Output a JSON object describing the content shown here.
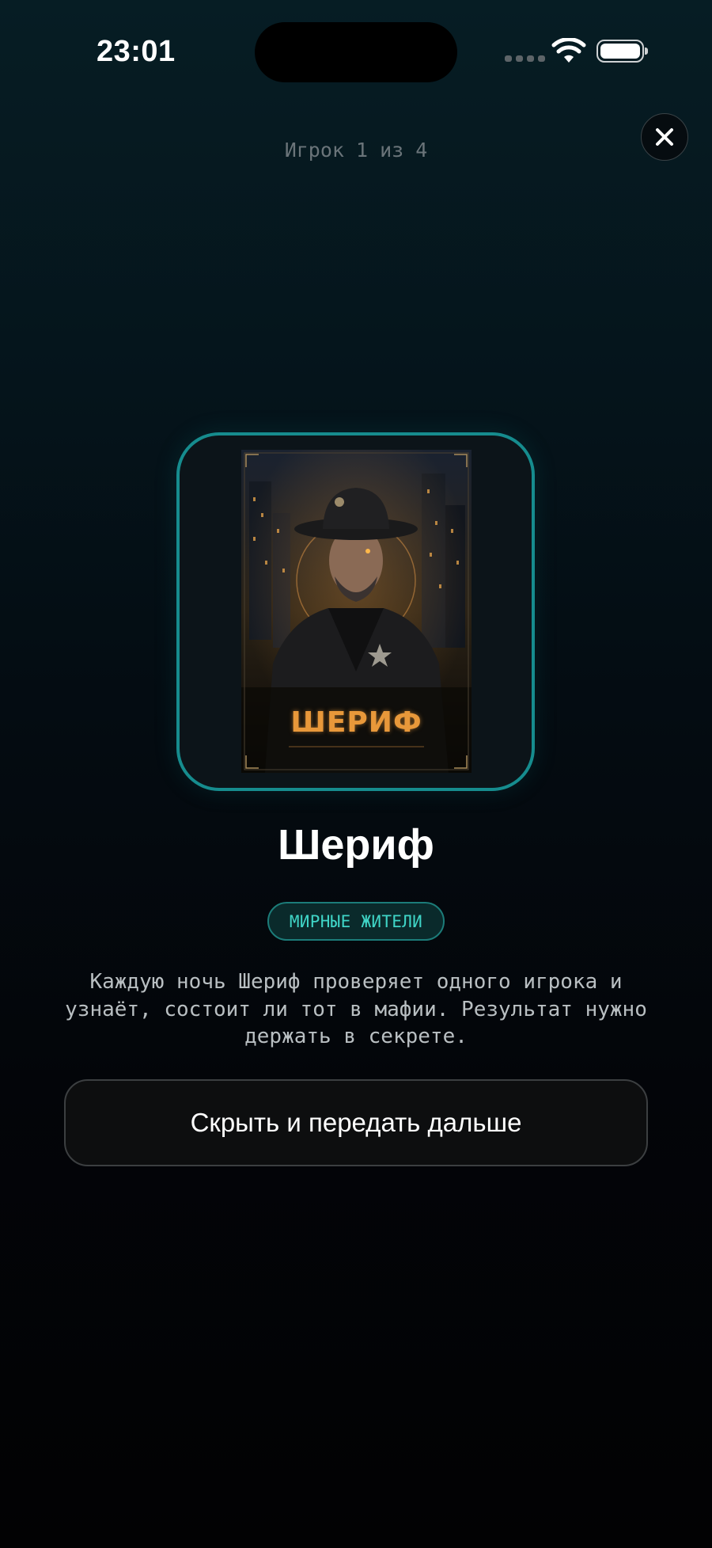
{
  "status_bar": {
    "time": "23:01"
  },
  "header": {
    "player_counter": "Игрок 1 из 4",
    "close_icon": "close-icon"
  },
  "role_card": {
    "art_title": "ШЕРИФ",
    "frame_color": "#168c8e"
  },
  "role": {
    "name": "Шериф",
    "team": "МИРНЫЕ ЖИТЕЛИ",
    "description": "Каждую ночь Шериф проверяет одного игрока и узнаёт, состоит ли тот в мафии. Результат нужно держать в секрете."
  },
  "actions": {
    "hide_and_pass_label": "Скрыть и передать дальше"
  },
  "colors": {
    "accent_teal": "#3fd4c6",
    "card_title_orange": "#e8983a"
  }
}
